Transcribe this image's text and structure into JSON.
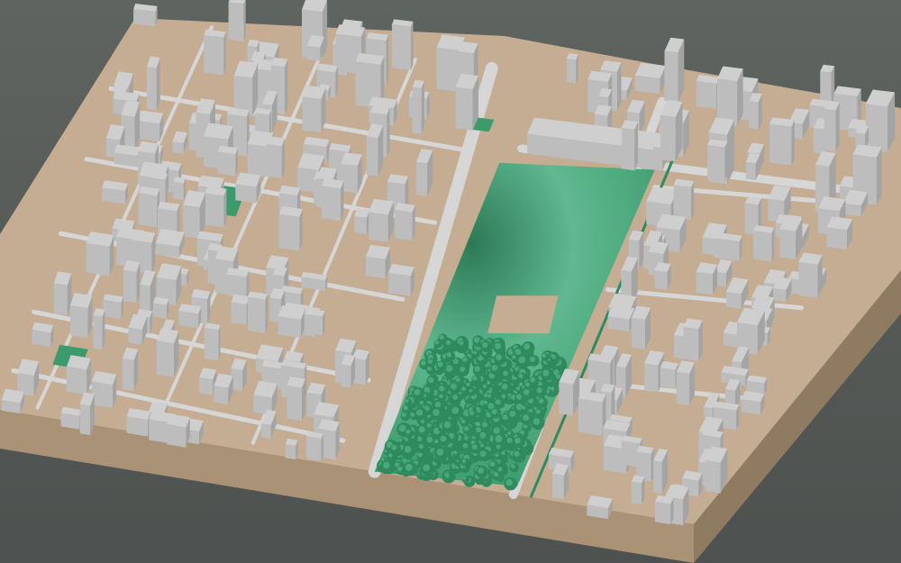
{
  "scene": {
    "type": "3d-city-terrain-model",
    "colors": {
      "background_top": "#5f6460",
      "background_bottom": "#4d514f",
      "ground": "#c4ad92",
      "base_side_front": "#a99275",
      "base_side_right": "#8f7a62",
      "road": "#d6d6d6",
      "building_top": "#cfcfcf",
      "building_left": "#bdbdbd",
      "building_right": "#a4a4a4",
      "hill_light": "#5fb88f",
      "hill_dark": "#2d7a56",
      "park": "#3d9a6d",
      "tree": "#2f8a5e",
      "tree_highlight": "#4aa97a",
      "rail": "#2e8a62"
    }
  }
}
